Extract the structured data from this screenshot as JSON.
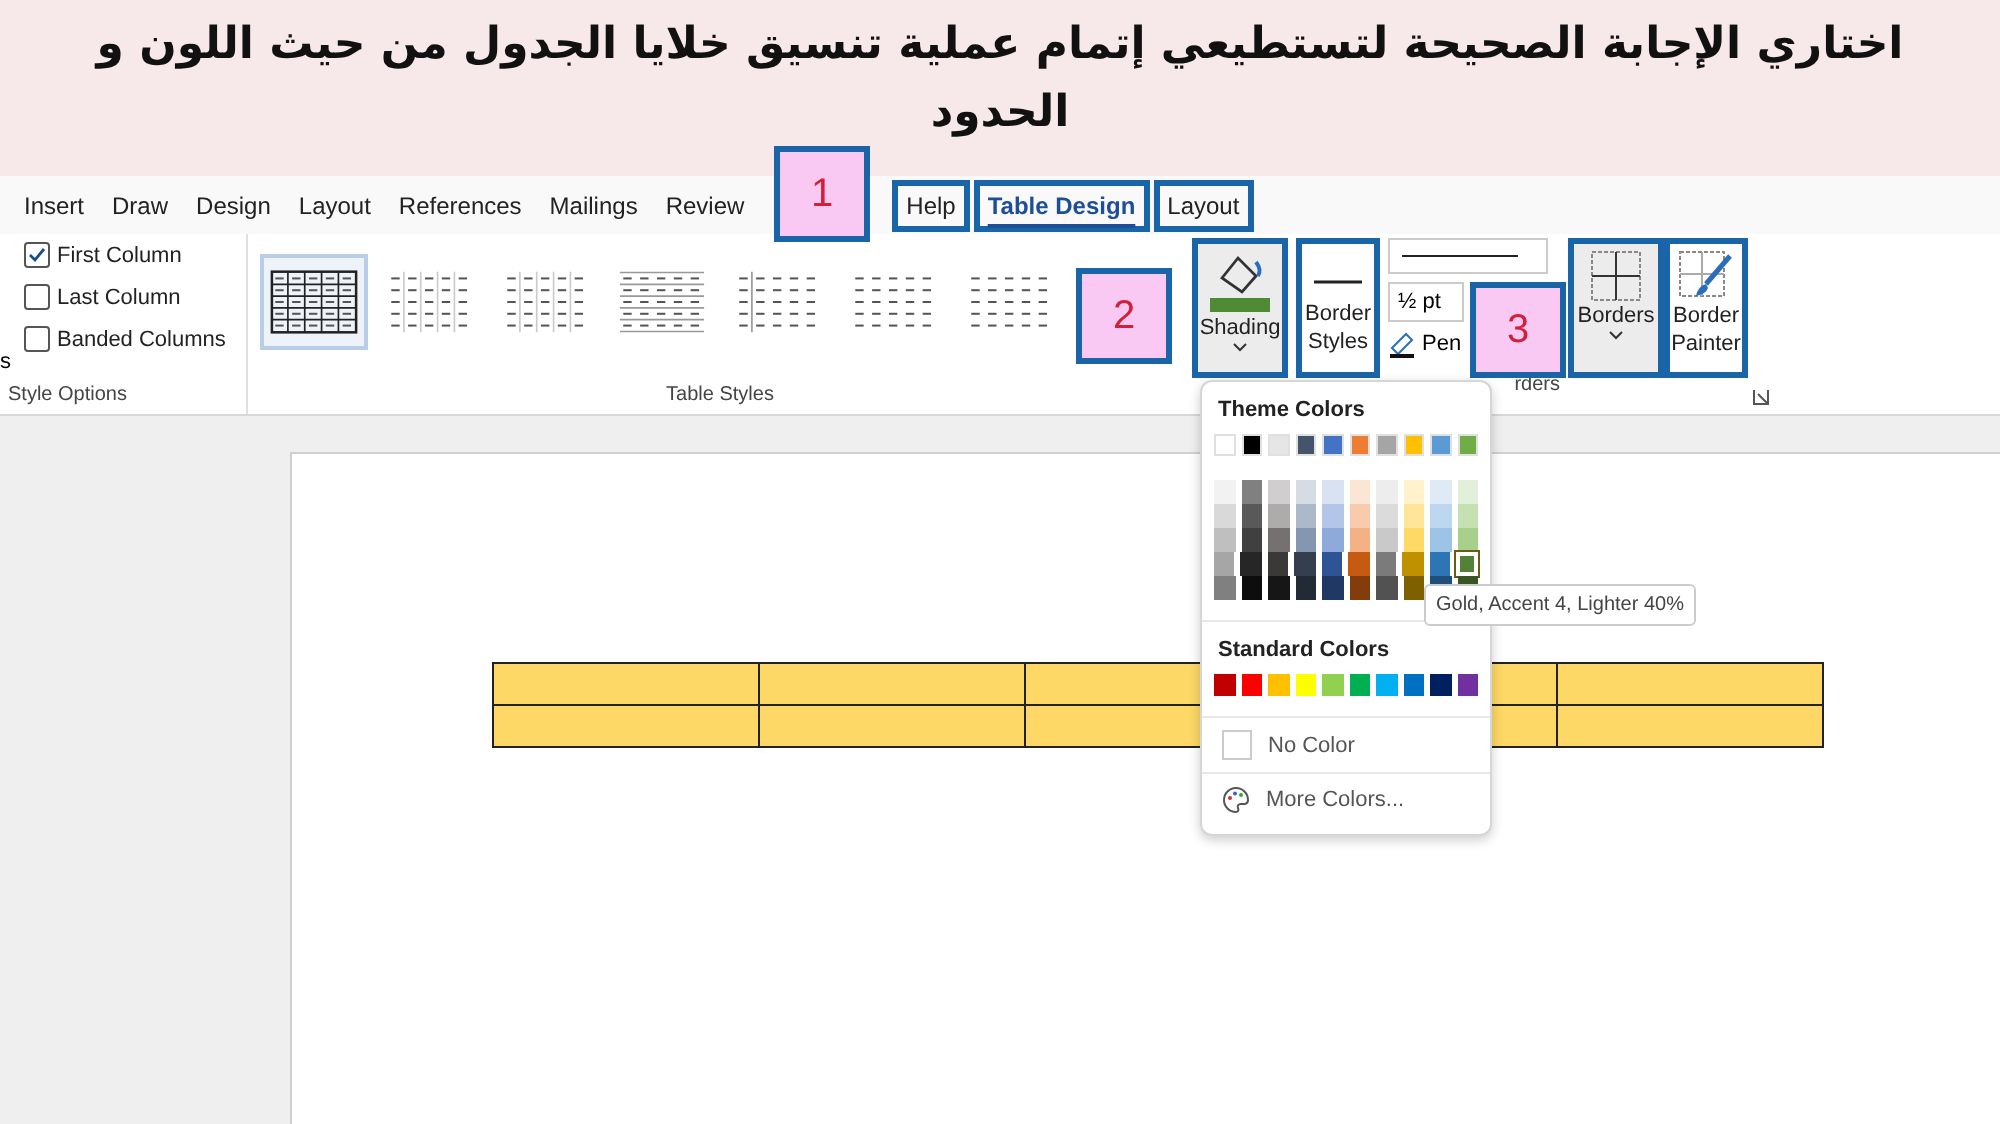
{
  "instruction": "اختاري الإجابة الصحيحة لتستطيعي إتمام عملية تنسيق خلايا الجدول من حيث اللون و الحدود",
  "tabs": [
    {
      "label": "Insert",
      "selected": false,
      "framed": false
    },
    {
      "label": "Draw",
      "selected": false,
      "framed": false
    },
    {
      "label": "Design",
      "selected": false,
      "framed": false
    },
    {
      "label": "Layout",
      "selected": false,
      "framed": false
    },
    {
      "label": "References",
      "selected": false,
      "framed": false
    },
    {
      "label": "Mailings",
      "selected": false,
      "framed": false
    },
    {
      "label": "Review",
      "selected": false,
      "framed": false
    },
    {
      "label": "Help",
      "selected": false,
      "framed": true
    },
    {
      "label": "Table Design",
      "selected": true,
      "framed": true
    },
    {
      "label": "Layout",
      "selected": false,
      "framed": true
    }
  ],
  "style_options": {
    "cut_label": "s",
    "checkboxes": [
      {
        "label": "First Column",
        "checked": true
      },
      {
        "label": "Last Column",
        "checked": false
      },
      {
        "label": "Banded Columns",
        "checked": false
      }
    ],
    "group_label": "Style Options"
  },
  "table_styles": {
    "thumbnails": [
      {
        "selected": true
      },
      {
        "selected": false
      },
      {
        "selected": false
      },
      {
        "selected": false
      },
      {
        "selected": false
      },
      {
        "selected": false
      },
      {
        "selected": false
      }
    ],
    "group_label": "Table Styles"
  },
  "shading_button": {
    "label": "Shading",
    "framed": true
  },
  "border_styles_button": {
    "label": "Border Styles",
    "framed": true
  },
  "pen_weight": "½ pt",
  "pen_color": "Pen",
  "borders_group_label": "rders",
  "borders_button": {
    "label": "Borders",
    "framed": true
  },
  "border_painter_button": {
    "label": "Border Painter",
    "framed": true
  },
  "markers": [
    {
      "label": "1"
    },
    {
      "label": "2"
    },
    {
      "label": "3"
    }
  ],
  "shading_menu": {
    "theme_title": "Theme Colors",
    "theme_colors": [
      {
        "color": "#ffffff"
      },
      {
        "color": "#000000"
      },
      {
        "color": "#e7e6e6"
      },
      {
        "color": "#44546a"
      },
      {
        "color": "#4472c4"
      },
      {
        "color": "#ed7d31"
      },
      {
        "color": "#a5a5a5"
      },
      {
        "color": "#ffc000"
      },
      {
        "color": "#5b9bd5"
      },
      {
        "color": "#70ad47"
      }
    ],
    "shade_rows": [
      [
        {
          "color": "#f2f2f2",
          "selected": false
        },
        {
          "color": "#808080",
          "selected": false
        },
        {
          "color": "#d0cece",
          "selected": false
        },
        {
          "color": "#d6dce4",
          "selected": false
        },
        {
          "color": "#d9e2f3",
          "selected": false
        },
        {
          "color": "#fbe5d5",
          "selected": false
        },
        {
          "color": "#ededed",
          "selected": false
        },
        {
          "color": "#fff2cc",
          "selected": false
        },
        {
          "color": "#deebf6",
          "selected": false
        },
        {
          "color": "#e2efd9",
          "selected": false
        }
      ],
      [
        {
          "color": "#d9d9d9",
          "selected": false
        },
        {
          "color": "#595959",
          "selected": false
        },
        {
          "color": "#aeabab",
          "selected": false
        },
        {
          "color": "#adb9ca",
          "selected": false
        },
        {
          "color": "#b4c6e7",
          "selected": false
        },
        {
          "color": "#f7cbac",
          "selected": false
        },
        {
          "color": "#dbdbdb",
          "selected": false
        },
        {
          "color": "#ffe599",
          "selected": false
        },
        {
          "color": "#bdd7ee",
          "selected": false
        },
        {
          "color": "#c5e0b3",
          "selected": false
        }
      ],
      [
        {
          "color": "#bfbfbf",
          "selected": false
        },
        {
          "color": "#404040",
          "selected": false
        },
        {
          "color": "#767171",
          "selected": false
        },
        {
          "color": "#8496b0",
          "selected": false
        },
        {
          "color": "#8eaadb",
          "selected": false
        },
        {
          "color": "#f4b183",
          "selected": false
        },
        {
          "color": "#c9c9c9",
          "selected": false
        },
        {
          "color": "#ffd966",
          "selected": false
        },
        {
          "color": "#9dc3e6",
          "selected": false
        },
        {
          "color": "#a8d08d",
          "selected": false
        }
      ],
      [
        {
          "color": "#a6a6a6",
          "selected": false
        },
        {
          "color": "#262626",
          "selected": false
        },
        {
          "color": "#3b3838",
          "selected": false
        },
        {
          "color": "#333f4f",
          "selected": false
        },
        {
          "color": "#2f5496",
          "selected": false
        },
        {
          "color": "#c55a11",
          "selected": false
        },
        {
          "color": "#7b7b7b",
          "selected": false
        },
        {
          "color": "#bf9000",
          "selected": false
        },
        {
          "color": "#2e75b5",
          "selected": false
        },
        {
          "color": "#538135",
          "selected": true
        }
      ],
      [
        {
          "color": "#808080",
          "selected": false
        },
        {
          "color": "#0d0d0d",
          "selected": false
        },
        {
          "color": "#171616",
          "selected": false
        },
        {
          "color": "#222a35",
          "selected": false
        },
        {
          "color": "#1f3864",
          "selected": false
        },
        {
          "color": "#833c0b",
          "selected": false
        },
        {
          "color": "#525252",
          "selected": false
        },
        {
          "color": "#7f6000",
          "selected": false
        },
        {
          "color": "#1f4e79",
          "selected": false
        },
        {
          "color": "#375623",
          "selected": false
        }
      ]
    ],
    "standard_title": "Standard Colors",
    "standard_colors": [
      {
        "color": "#c00000"
      },
      {
        "color": "#ff0000"
      },
      {
        "color": "#ffc000"
      },
      {
        "color": "#ffff00"
      },
      {
        "color": "#92d050"
      },
      {
        "color": "#00b050"
      },
      {
        "color": "#00b0f0"
      },
      {
        "color": "#0070c0"
      },
      {
        "color": "#002060"
      },
      {
        "color": "#7030a0"
      }
    ],
    "no_color": "No Color",
    "more_colors": "More Colors..."
  },
  "tooltip": "Gold, Accent 4, Lighter 40%"
}
